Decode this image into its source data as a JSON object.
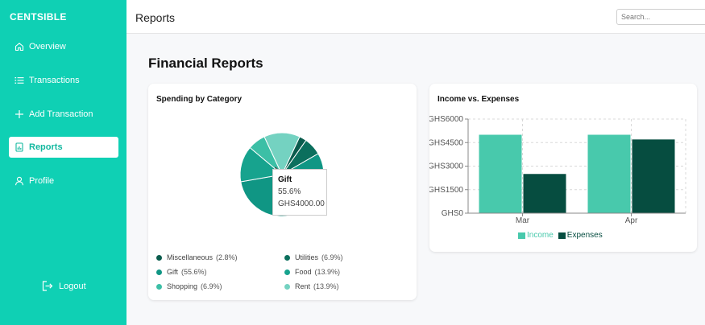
{
  "app": {
    "brand": "CENTSIBLE"
  },
  "sidebar": {
    "items": [
      {
        "label": "Overview",
        "icon": "home-icon"
      },
      {
        "label": "Transactions",
        "icon": "list-icon"
      },
      {
        "label": "Add Transaction",
        "icon": "plus-icon"
      },
      {
        "label": "Reports",
        "icon": "report-icon",
        "active": true
      },
      {
        "label": "Profile",
        "icon": "user-icon"
      }
    ],
    "logout_label": "Logout"
  },
  "header": {
    "title": "Reports",
    "search_placeholder": "Search..."
  },
  "main": {
    "heading": "Financial Reports",
    "spending_card": {
      "title": "Spending by Category",
      "tooltip": {
        "name": "Gift",
        "percent": "55.6%",
        "amount": "GHS4000.00"
      },
      "legend": [
        {
          "name": "Miscellaneous",
          "percent": "(2.8%)",
          "color": "#0a5c4d"
        },
        {
          "name": "Utilities",
          "percent": "(6.9%)",
          "color": "#0b6f5d"
        },
        {
          "name": "Gift",
          "percent": "(55.6%)",
          "color": "#109684"
        },
        {
          "name": "Food",
          "percent": "(13.9%)",
          "color": "#17a38e"
        },
        {
          "name": "Shopping",
          "percent": "(6.9%)",
          "color": "#3cbfa6"
        },
        {
          "name": "Rent",
          "percent": "(13.9%)",
          "color": "#74d2c1"
        }
      ]
    },
    "income_card": {
      "title": "Income vs. Expenses"
    }
  },
  "colors": {
    "sidebar_bg": "#0fd0b4",
    "income": "#48c9ac",
    "expenses": "#064d40"
  },
  "chart_data": [
    {
      "type": "pie",
      "title": "Spending by Category",
      "categories": [
        "Miscellaneous",
        "Utilities",
        "Gift",
        "Food",
        "Shopping",
        "Rent"
      ],
      "values": [
        2.8,
        6.9,
        55.6,
        13.9,
        6.9,
        13.9
      ],
      "unit": "%",
      "legend": "bottom"
    },
    {
      "type": "bar",
      "title": "Income vs. Expenses",
      "categories": [
        "Mar",
        "Apr"
      ],
      "series": [
        {
          "name": "Income",
          "values": [
            5000,
            5000
          ]
        },
        {
          "name": "Expenses",
          "values": [
            2500,
            4700
          ]
        }
      ],
      "ylim": [
        0,
        6000
      ],
      "yticks": [
        "GHS0",
        "GHS1500",
        "GHS3000",
        "GHS4500",
        "GHS6000"
      ],
      "grid": true,
      "legend": "bottom"
    }
  ]
}
